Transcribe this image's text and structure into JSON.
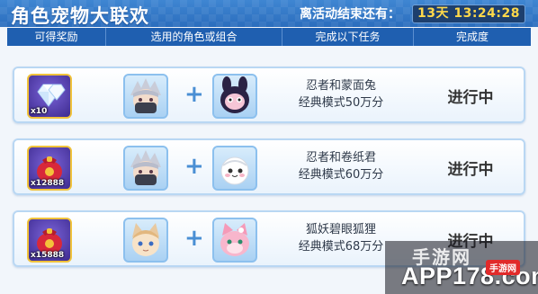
{
  "header": {
    "title": "角色宠物大联欢",
    "countdown_label": "离活动结束还有：",
    "countdown": "13天 13:24:28"
  },
  "columns": [
    "可得奖励",
    "选用的角色或组合",
    "完成以下任务",
    "完成度"
  ],
  "rows": [
    {
      "reward_icon": "diamond-icon",
      "reward_count": "x10",
      "char_a_icon": "ninja-character-icon",
      "char_b_icon": "masked-rabbit-pet-icon",
      "task_line1": "忍者和蒙面兔",
      "task_line2": "经典模式50万分",
      "status": "进行中"
    },
    {
      "reward_icon": "red-gift-bag-icon",
      "reward_count": "x12888",
      "char_a_icon": "ninja-character-icon",
      "char_b_icon": "paper-roll-pet-icon",
      "task_line1": "忍者和卷纸君",
      "task_line2": "经典模式60万分",
      "status": "进行中"
    },
    {
      "reward_icon": "red-gift-bag-icon",
      "reward_count": "x15888",
      "char_a_icon": "fox-girl-character-icon",
      "char_b_icon": "pink-fox-pet-icon",
      "task_line1": "狐妖碧眼狐狸",
      "task_line2": "经典模式68万分",
      "status": "进行中"
    }
  ],
  "watermark": {
    "top": "手游网",
    "main": "APP178.com",
    "badge": "手游网"
  },
  "colors": {
    "header_blue": "#2f73c3",
    "column_bar": "#1f5fb0",
    "countdown_text": "#ffd84a",
    "row_border": "#b9d7f3",
    "reward_border": "#f0c23a"
  }
}
